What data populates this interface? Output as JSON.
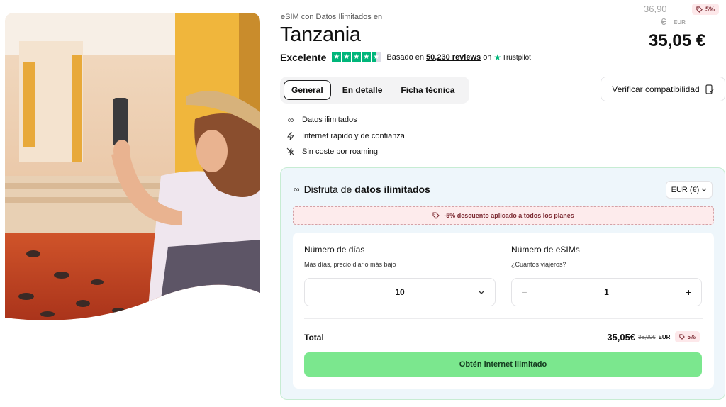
{
  "product": {
    "subtitle": "eSIM con Datos Ilimitados en",
    "title": "Tanzania"
  },
  "rating": {
    "word": "Excelente",
    "score_stars": 4.5,
    "based_prefix": "Basado en",
    "reviews": "50,230 reviews",
    "on": "on",
    "provider": "Trustpilot"
  },
  "price": {
    "old": "36,90",
    "old_currency": "€",
    "old_code": "EUR",
    "discount": "5%",
    "current": "35,05 €"
  },
  "tabs": [
    {
      "label": "General",
      "active": true
    },
    {
      "label": "En detalle",
      "active": false
    },
    {
      "label": "Ficha técnica",
      "active": false
    }
  ],
  "compat_button": "Verificar compatibilidad",
  "features": [
    {
      "icon": "infinity-icon",
      "label": "Datos ilimitados"
    },
    {
      "icon": "lightning-icon",
      "label": "Internet rápido y de confianza"
    },
    {
      "icon": "no-roaming-icon",
      "label": "Sin coste por roaming"
    }
  ],
  "panel": {
    "heading_prefix": "Disfruta de",
    "heading_bold": "datos ilimitados",
    "currency": "EUR (€)",
    "promo": "-5% descuento aplicado a todos los planes",
    "days_label": "Número de días",
    "days_sub": "Más días, precio diario más bajo",
    "days_value": "10",
    "esims_label": "Número de eSIMs",
    "esims_sub": "¿Cuántos viajeros?",
    "esims_value": "1",
    "minus": "−",
    "plus": "+",
    "total_label": "Total",
    "total_price": "35,05€",
    "total_old": "36,90€",
    "total_code": "EUR",
    "total_discount": "5%",
    "cta": "Obtén internet ilimitado"
  },
  "colors": {
    "accent_green": "#7be78e",
    "trustpilot_green": "#00b67a",
    "discount_bg": "#fde8ea",
    "panel_bg": "#eef6fb"
  }
}
